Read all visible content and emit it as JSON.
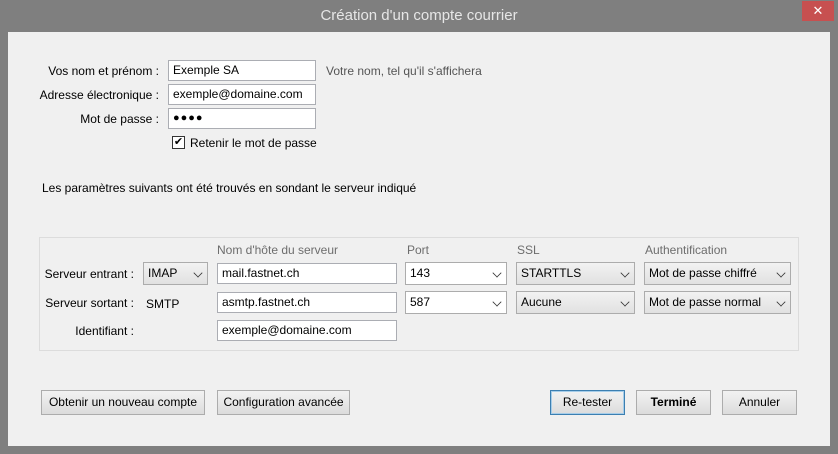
{
  "window": {
    "title": "Création d'un compte courrier",
    "close_glyph": "✕"
  },
  "form": {
    "name_label": "Vos nom et prénom :",
    "name_value": "Exemple SA",
    "name_hint": "Votre nom, tel qu'il s'affichera",
    "email_label": "Adresse électronique :",
    "email_value": "exemple@domaine.com",
    "password_label": "Mot de passe :",
    "password_value": "●●●●",
    "remember_label": "Retenir le mot de passe",
    "remember_check": "✔",
    "found_message": "Les paramètres suivants ont été trouvés en sondant le serveur indiqué"
  },
  "servers": {
    "columns": {
      "hostname": "Nom d'hôte du serveur",
      "port": "Port",
      "ssl": "SSL",
      "auth": "Authentification"
    },
    "incoming": {
      "label": "Serveur entrant :",
      "protocol": "IMAP",
      "hostname": "mail.fastnet.ch",
      "port": "143",
      "ssl": "STARTTLS",
      "auth": "Mot de passe chiffré"
    },
    "outgoing": {
      "label": "Serveur sortant :",
      "protocol": "SMTP",
      "hostname": "asmtp.fastnet.ch",
      "port": "587",
      "ssl": "Aucune",
      "auth": "Mot de passe normal"
    },
    "identifier": {
      "label": "Identifiant :",
      "value": "exemple@domaine.com"
    }
  },
  "buttons": {
    "new_account": "Obtenir un nouveau compte",
    "advanced": "Configuration avancée",
    "retest": "Re-tester",
    "done": "Terminé",
    "cancel": "Annuler"
  }
}
